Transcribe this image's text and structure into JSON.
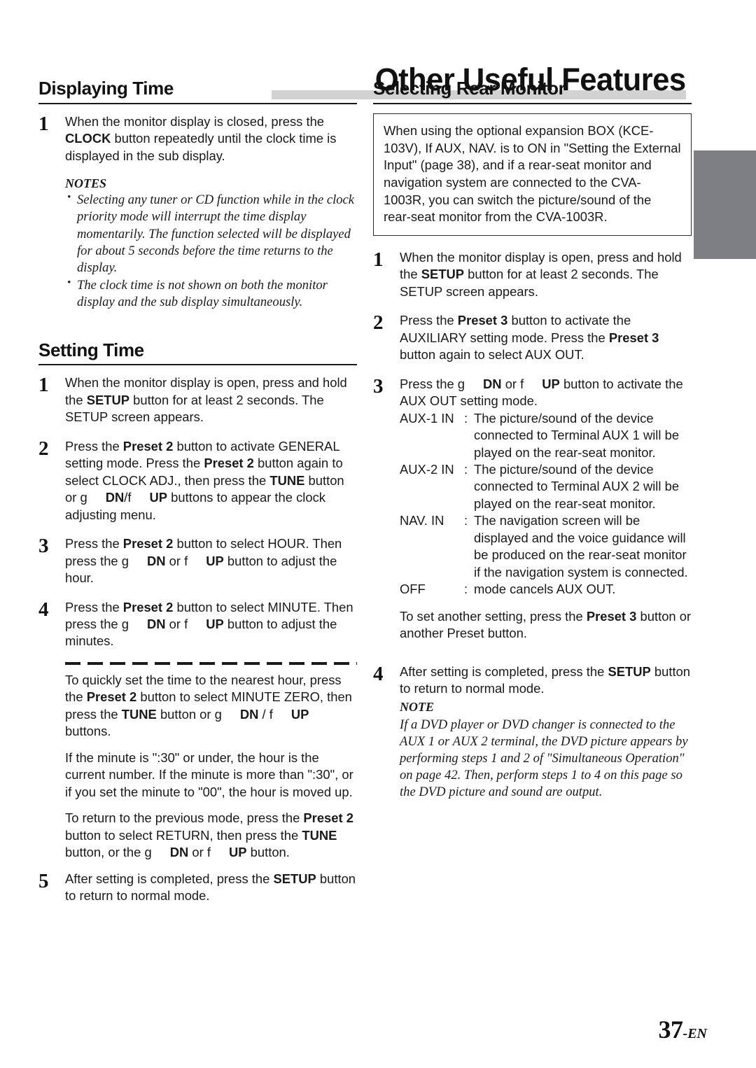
{
  "page": {
    "banner_title": "Other Useful Features",
    "page_number": "37",
    "page_number_suffix": "-EN",
    "accent_bar_color": "#d2d2d2",
    "edge_tab_color": "#7e7f83"
  },
  "left_column": {
    "section1": {
      "heading": "Displaying Time",
      "step1": {
        "number": "1",
        "text_a": "When the monitor display is closed, press the ",
        "bold_b": "CLOCK",
        "text_c": " button repeatedly until the clock time is displayed in the sub display."
      },
      "notes_title": "NOTES",
      "notes": [
        "Selecting any tuner or CD function while in the clock priority mode will interrupt the time display momentarily. The function selected will be displayed for about 5 seconds before the time returns to the display.",
        "The clock time is not shown on both the monitor display and the sub display simultaneously."
      ]
    },
    "section2": {
      "heading": "Setting Time",
      "step1": {
        "number": "1",
        "text_a": "When the monitor display is open, press and hold the ",
        "bold_b": "SETUP",
        "text_c": " button for at least 2 seconds. The SETUP screen appears."
      },
      "step2": {
        "number": "2",
        "text_a": "Press the ",
        "bold_b": "Preset 2",
        "text_c": " button to activate GENERAL setting mode. Press the ",
        "bold_d": "Preset 2",
        "text_e": " button again to select CLOCK ADJ., then press the ",
        "bold_f": "TUNE",
        "text_g": " button or g",
        "bold_h": "DN",
        "text_i": "/f",
        "bold_j": "UP",
        "text_k": " buttons to appear the clock adjusting menu."
      },
      "step3": {
        "number": "3",
        "text_a": "Press the ",
        "bold_b": "Preset 2",
        "text_c": " button to select HOUR. Then press the g",
        "bold_d": "DN",
        "text_e": " or f",
        "bold_f": "UP",
        "text_g": " button to adjust the hour."
      },
      "step4": {
        "number": "4",
        "text_a": "Press the ",
        "bold_b": "Preset 2",
        "text_c": " button to select MINUTE. Then press the g",
        "bold_d": "DN",
        "text_e": " or f",
        "bold_f": "UP",
        "text_g": " button to adjust the minutes."
      },
      "tip1": {
        "text_a": "To quickly set the time to the nearest hour, press the ",
        "bold_b": "Preset 2",
        "text_c": " button to select MINUTE ZERO, then press the ",
        "bold_d": "TUNE",
        "text_e": " button or g",
        "bold_f": "DN",
        "text_g": " / f",
        "bold_h": "UP",
        "text_i": " buttons."
      },
      "tip2": "If the minute is \":30\" or under, the hour is the current number. If the minute is more than \":30\", or if you set the minute to \"00\", the hour is moved up.",
      "tip3": {
        "text_a": "To return to the previous mode, press the ",
        "bold_b": "Preset 2",
        "text_c": " button to select RETURN, then press the ",
        "bold_d": "TUNE",
        "text_e": " button, or the g",
        "bold_f": "DN",
        "text_g": " or f",
        "bold_h": "UP",
        "text_i": " button."
      },
      "step5": {
        "number": "5",
        "text_a": "After setting is completed, press the ",
        "bold_b": "SETUP",
        "text_c": " button to return to normal mode."
      }
    }
  },
  "right_column": {
    "heading": "Selecting Rear Monitor",
    "callout": "When using the optional expansion BOX (KCE-103V), If AUX, NAV. is to ON in \"Setting the External Input\" (page 38), and if a rear-seat monitor and navigation system are connected to the CVA-1003R, you can switch the picture/sound of the rear-seat monitor from the CVA-1003R.",
    "step1": {
      "number": "1",
      "text_a": "When the monitor display is open, press and hold the ",
      "bold_b": "SETUP",
      "text_c": " button for at least 2 seconds. The SETUP screen appears."
    },
    "step2": {
      "number": "2",
      "text_a": "Press the ",
      "bold_b": "Preset 3",
      "text_c": " button to activate the AUXILIARY setting mode. Press the ",
      "bold_d": "Preset 3",
      "text_e": " button again to select AUX OUT."
    },
    "step3": {
      "number": "3",
      "text_a": "Press the g",
      "bold_b": "DN",
      "text_c": " or f",
      "bold_d": "UP",
      "text_e": " button to activate the AUX OUT setting mode."
    },
    "aux_modes": [
      {
        "term": "AUX-1 IN",
        "colon": ":",
        "desc": "The picture/sound of the device connected to Terminal AUX 1 will be played on the rear-seat monitor."
      },
      {
        "term": "AUX-2 IN",
        "colon": ":",
        "desc": "The picture/sound of the device connected to Terminal AUX 2 will be played on the rear-seat monitor."
      },
      {
        "term": "NAV. IN",
        "colon": ":",
        "desc": "The navigation screen will be displayed and the voice guidance will be produced on the rear-seat monitor if the navigation system is connected."
      },
      {
        "term": "OFF",
        "colon": ":",
        "desc": "mode cancels AUX OUT."
      }
    ],
    "after_modes": {
      "text_a": "To set another setting, press the ",
      "bold_b": "Preset 3",
      "text_c": " button or another Preset button."
    },
    "step4": {
      "number": "4",
      "text_a": "After setting is completed, press the ",
      "bold_b": "SETUP",
      "text_c": " button to return to normal mode."
    },
    "note_title": "NOTE",
    "note_body": "If a DVD player or DVD changer is connected to the AUX 1 or AUX 2 terminal, the DVD picture appears by performing steps 1 and 2 of \"Simultaneous Operation\" on page 42. Then, perform steps 1 to 4 on this page so the DVD picture and sound are output."
  }
}
